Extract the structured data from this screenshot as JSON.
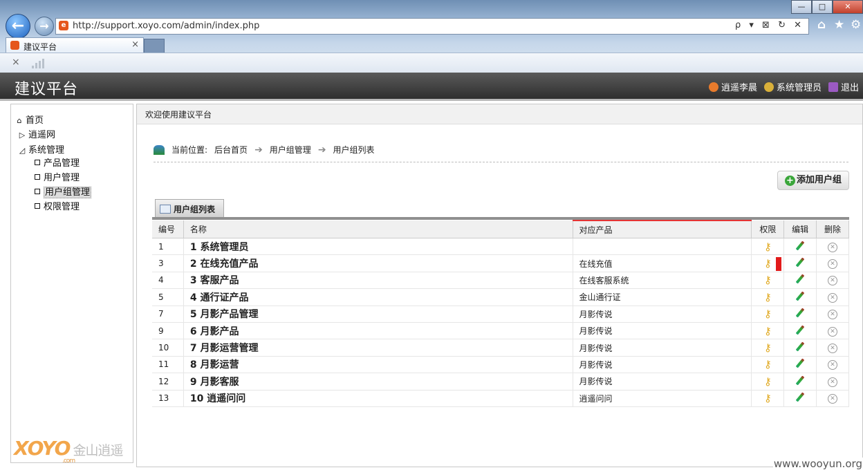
{
  "browser": {
    "url": "http://support.xoyo.com/admin/index.php",
    "tab_title": "建议平台",
    "tab_close": "×",
    "addr_controls": "ρ ▾ ⊠ ↻ ✕",
    "window_buttons": [
      "—",
      "□",
      "✕"
    ],
    "right_icons": [
      "⌂",
      "★",
      "⚙"
    ],
    "cmd_close": "×"
  },
  "header": {
    "title": "建议平台",
    "user_name": "逍遥李晨",
    "role": "系统管理员",
    "logout": "退出"
  },
  "sidebar": {
    "home": "首页",
    "xoyo": "逍遥网",
    "sysmgmt": "系统管理",
    "items": [
      "产品管理",
      "用户管理",
      "用户组管理",
      "权限管理"
    ],
    "selected": "用户组管理",
    "logo_text": "XOYO",
    "logo_cn": "金山逍遥",
    "logo_com": ".com"
  },
  "main": {
    "welcome": "欢迎使用建议平台",
    "breadcrumb_label": "当前位置:",
    "breadcrumb": [
      "后台首页",
      "用户组管理",
      "用户组列表"
    ],
    "add_button": "添加用户组",
    "list_tab": "用户组列表"
  },
  "table": {
    "headers": [
      "编号",
      "名称",
      "对应产品",
      "权限",
      "编辑",
      "删除"
    ],
    "rows": [
      {
        "id": "1",
        "name": "1 系统管理员",
        "product": ""
      },
      {
        "id": "3",
        "name": "2 在线充值产品",
        "product": "在线充值"
      },
      {
        "id": "4",
        "name": "3 客服产品",
        "product": "在线客服系统"
      },
      {
        "id": "5",
        "name": "4 通行证产品",
        "product": "金山通行证"
      },
      {
        "id": "7",
        "name": "5 月影产品管理",
        "product": "月影传说"
      },
      {
        "id": "9",
        "name": "6 月影产品",
        "product": "月影传说"
      },
      {
        "id": "10",
        "name": "7 月影运营管理",
        "product": "月影传说"
      },
      {
        "id": "11",
        "name": "8 月影运营",
        "product": "月影传说"
      },
      {
        "id": "12",
        "name": "9 月影客服",
        "product": "月影传说"
      },
      {
        "id": "13",
        "name": "10 逍遥问问",
        "product": "逍遥问问"
      }
    ]
  },
  "watermark": "www.wooyun.org",
  "colors": {
    "header_bg": "#3c3c3c",
    "accent_red": "#e53333",
    "key": "#e0a81f",
    "add_green": "#3aa63a"
  },
  "icons": {
    "permission": "key-icon",
    "edit": "pencil-icon",
    "delete": "delete-icon"
  }
}
